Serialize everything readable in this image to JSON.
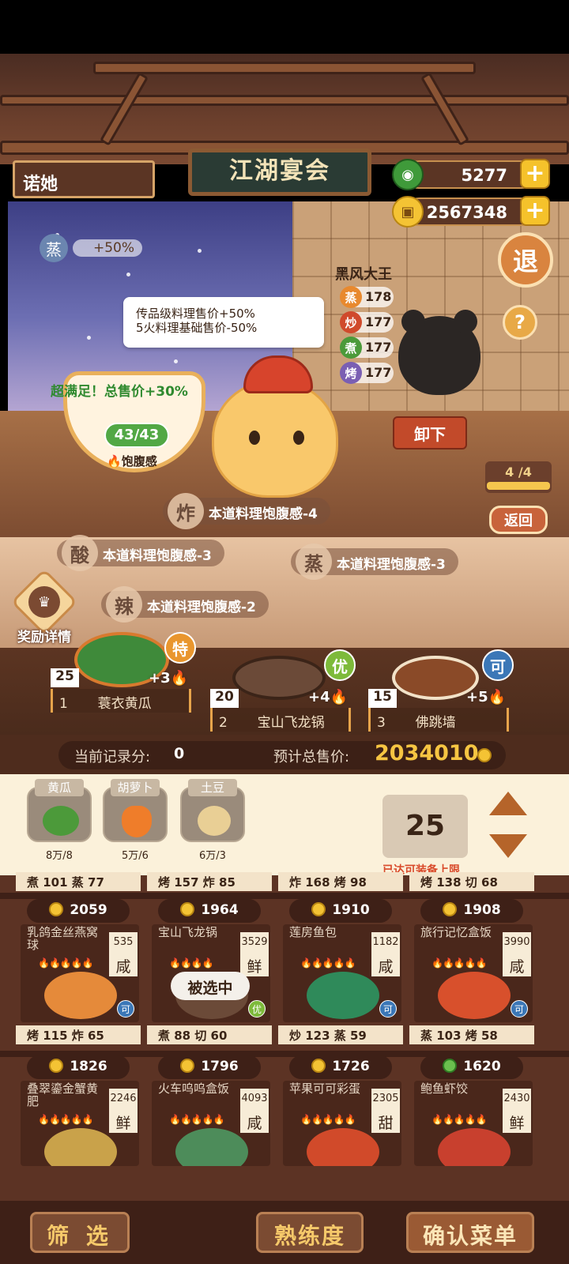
{
  "header": {
    "player_name": "诺她",
    "title": "江湖宴会"
  },
  "currency": {
    "jade": "5277",
    "coins": "2567348",
    "plus": "+"
  },
  "buttons": {
    "retreat": "退",
    "help": "?",
    "unload": "卸下",
    "return": "返回",
    "filter": "筛 选",
    "proficiency": "熟练度",
    "confirm": "确认菜单"
  },
  "buff": {
    "steam_badge": "蒸",
    "steam_pct": "+50%"
  },
  "tooltip": {
    "line1": "传品级料理售价+50%",
    "line2": "5火料理基础售价-50%"
  },
  "opponent": {
    "name": "黑风大王",
    "stats": [
      {
        "badge": "蒸",
        "value": "178",
        "color": "#e8892e"
      },
      {
        "badge": "炒",
        "value": "177",
        "color": "#d04a2c"
      },
      {
        "badge": "煮",
        "value": "177",
        "color": "#4b9a3a"
      },
      {
        "badge": "烤",
        "value": "177",
        "color": "#7a5fb3"
      }
    ]
  },
  "page": {
    "indicator": "4 /4"
  },
  "bowl": {
    "status": "超满足！总售价+30%",
    "fullness": "43/43",
    "fullness_label": "饱腹感"
  },
  "penalties": [
    {
      "badge": "炸",
      "text": "本道料理饱腹感-4"
    },
    {
      "badge": "酸",
      "text": "本道料理饱腹感-3"
    },
    {
      "badge": "蒸",
      "text": "本道料理饱腹感-3"
    },
    {
      "badge": "辣",
      "text": "本道料理饱腹感-2"
    }
  ],
  "reward": {
    "label": "奖励详情"
  },
  "menu_dishes": [
    {
      "index": "1",
      "name": "蓑衣黄瓜",
      "qty": "25",
      "bonus": "+3",
      "grade": "特",
      "grade_color": "#e9962e"
    },
    {
      "index": "2",
      "name": "宝山飞龙锅",
      "qty": "20",
      "bonus": "+4",
      "grade": "优",
      "grade_color": "#7dba3a"
    },
    {
      "index": "3",
      "name": "佛跳墙",
      "qty": "15",
      "bonus": "+5",
      "grade": "可",
      "grade_color": "#3b77b7"
    }
  ],
  "score": {
    "record_label": "当前记录分:",
    "record_value": "0",
    "total_label": "预计总售价:",
    "total_value": "2034010"
  },
  "ingredients": [
    {
      "name": "黄瓜",
      "qty": "8万/8"
    },
    {
      "name": "胡萝卜",
      "qty": "5万/6"
    },
    {
      "name": "土豆",
      "qty": "6万/3"
    }
  ],
  "stepper": {
    "value": "25",
    "limit_text": "已达可装备上限"
  },
  "top_stats": [
    {
      "a": "煮",
      "av": "101",
      "b": "蒸",
      "bv": "77"
    },
    {
      "a": "烤",
      "av": "157",
      "b": "炸",
      "bv": "85"
    },
    {
      "a": "炸",
      "av": "168",
      "b": "烤",
      "bv": "98"
    },
    {
      "a": "烤",
      "av": "138",
      "b": "切",
      "bv": "68"
    }
  ],
  "recipes_row1": [
    {
      "price": "2059",
      "title": "乳鸽金丝燕窝球",
      "count": "535",
      "flavor": "咸",
      "flames": "🔥🔥🔥🔥🔥",
      "grade": "可",
      "stats": "烤 115 炸 65",
      "food_color": "#e58a3a"
    },
    {
      "price": "1964",
      "title": "宝山飞龙锅",
      "count": "3529",
      "flavor": "鲜",
      "flames": "🔥🔥🔥🔥",
      "grade": "优",
      "stats": "煮 88 切 60",
      "food_color": "#6b4a38",
      "selected": "被选中"
    },
    {
      "price": "1910",
      "title": "莲房鱼包",
      "count": "1182",
      "flavor": "咸",
      "flames": "🔥🔥🔥🔥🔥",
      "grade": "可",
      "stats": "炒 123 蒸 59",
      "food_color": "#2f8a5a"
    },
    {
      "price": "1908",
      "title": "旅行记忆盒饭",
      "count": "3990",
      "flavor": "咸",
      "flames": "🔥🔥🔥🔥🔥",
      "grade": "可",
      "stats": "蒸 103 烤 58",
      "food_color": "#d8502c"
    }
  ],
  "recipes_row2": [
    {
      "price": "1826",
      "title": "叠翠鎏金蟹黄肥",
      "count": "2246",
      "flavor": "鲜",
      "flames": "🔥🔥🔥🔥🔥",
      "food_color": "#c9a24a"
    },
    {
      "price": "1796",
      "title": "火车呜呜盒饭",
      "count": "4093",
      "flavor": "咸",
      "flames": "🔥🔥🔥🔥🔥",
      "food_color": "#4d8c5a"
    },
    {
      "price": "1726",
      "title": "苹果可可彩蛋",
      "count": "2305",
      "flavor": "甜",
      "flames": "🔥🔥🔥🔥🔥",
      "food_color": "#d14a2a"
    },
    {
      "price": "1620",
      "title": "鲍鱼虾饺",
      "count": "2430",
      "flavor": "鲜",
      "flames": "🔥🔥🔥🔥🔥",
      "food_color": "#c8402e"
    }
  ]
}
